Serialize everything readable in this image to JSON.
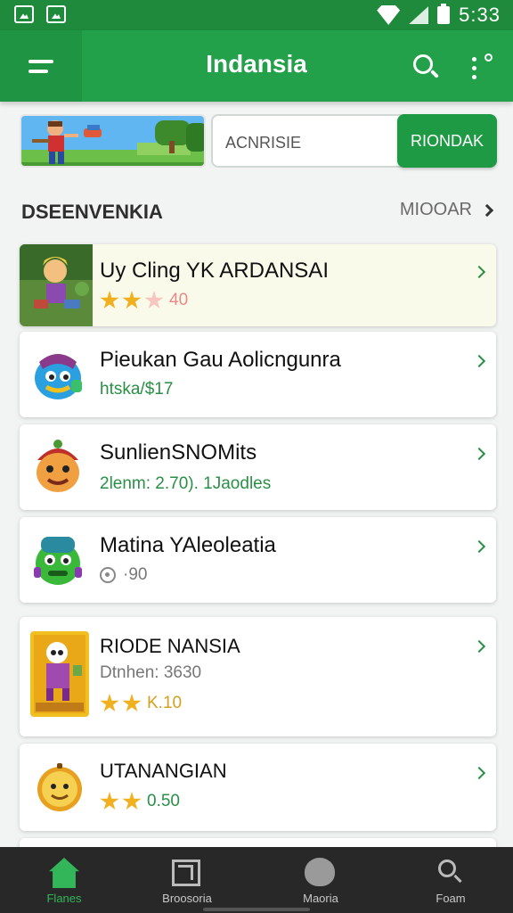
{
  "status_bar": {
    "time": "5:33",
    "icons": [
      "gallery-icon",
      "image-icon",
      "wifi-icon",
      "signal-icon",
      "battery-icon"
    ]
  },
  "app_bar": {
    "title": "Indansia",
    "menu_icon": "hamburger-icon",
    "search_icon": "search-icon",
    "more_icon": "more-vert-icon"
  },
  "search": {
    "value": "ACNRISIE",
    "button_label": "RIONDAK"
  },
  "section": {
    "title": "DSEENVENKIA",
    "more_label": "MIOOAR"
  },
  "list": [
    {
      "title": "Uy Cling YK ARDANSAI",
      "rating_stars": 2,
      "subtitle": "40",
      "subtitle_style": "stars-pink"
    },
    {
      "title": "Pieukan Gau Aolicngunra",
      "subtitle": "htska/$17",
      "subtitle_style": "green"
    },
    {
      "title": "SunlienSNOMits",
      "subtitle": "2lenm: 2.70). 1Jaodles",
      "subtitle_style": "green"
    },
    {
      "title": "Matina YAleoleatia",
      "subtitle": "·90",
      "subtitle_style": "icon-grey"
    },
    {
      "title": "RIODE NANSIA",
      "meta": "Dtnhen: 3630",
      "rating_stars": 2,
      "subtitle": "K.10",
      "subtitle_style": "stars-orange"
    },
    {
      "title": "UTANANGIAN",
      "rating_stars": 2,
      "subtitle": "0.50",
      "subtitle_style": "stars-green"
    }
  ],
  "bottom_nav": [
    {
      "label": "Flanes",
      "icon": "home-icon",
      "active": true
    },
    {
      "label": "Broosoria",
      "icon": "box-icon",
      "active": false
    },
    {
      "label": "Maoria",
      "icon": "blob-icon",
      "active": false
    },
    {
      "label": "Foam",
      "icon": "search-icon",
      "active": false
    }
  ],
  "colors": {
    "primary": "#23a04a",
    "primary_dark": "#1f8a3c",
    "accent_text": "#2a8f46",
    "star": "#f0b020",
    "nav_bg": "#282828"
  }
}
